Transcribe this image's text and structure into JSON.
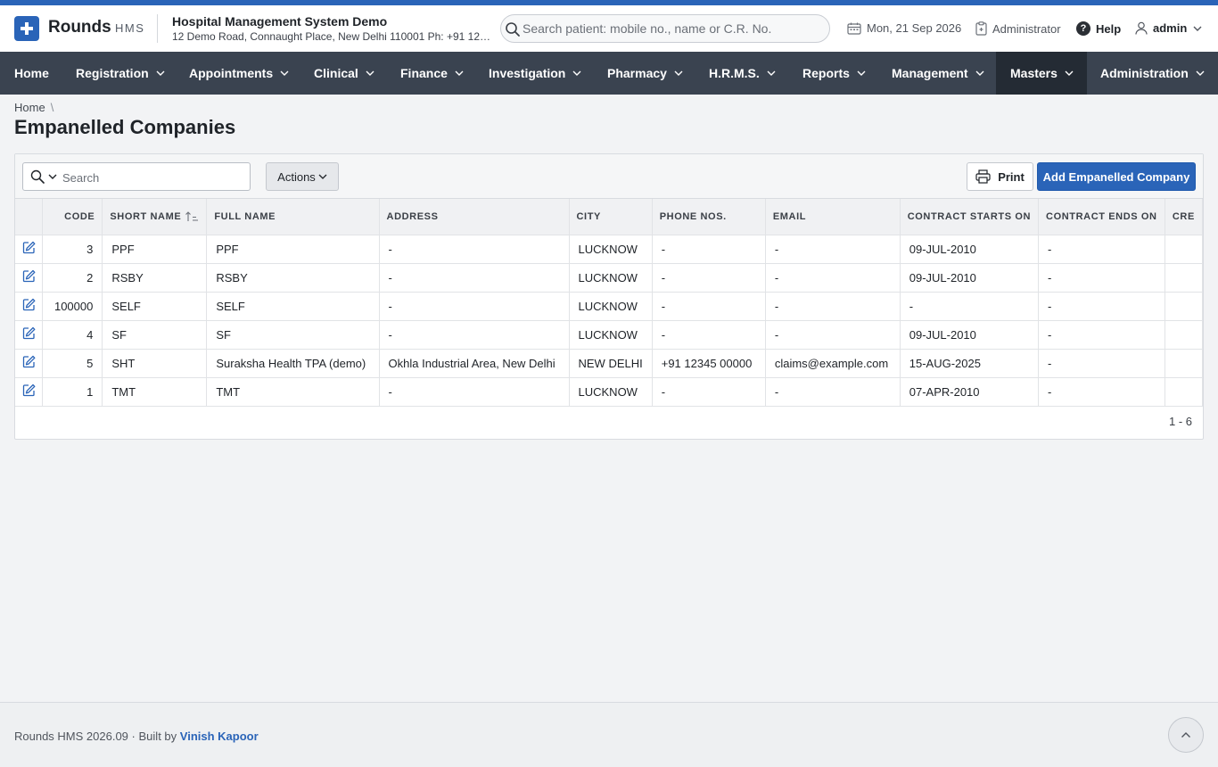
{
  "brand": {
    "name": "Rounds",
    "sub": "HMS"
  },
  "hospital": {
    "name": "Hospital Management System Demo",
    "address": "12 Demo Road, Connaught Place, New Delhi 110001 Ph: +91 123..."
  },
  "header_search": {
    "placeholder": "Search patient: mobile no., name or C.R. No."
  },
  "header": {
    "date": "Mon, 21 Sep 2026",
    "role": "Administrator",
    "help": "Help",
    "help_glyph": "?",
    "user": "admin"
  },
  "nav": {
    "items": [
      "Home",
      "Registration",
      "Appointments",
      "Clinical",
      "Finance",
      "Investigation",
      "Pharmacy",
      "H.R.M.S.",
      "Reports",
      "Management",
      "Masters",
      "Administration"
    ],
    "active": "Masters"
  },
  "breadcrumb": {
    "home": "Home",
    "separator": "\\"
  },
  "page": {
    "title": "Empanelled Companies"
  },
  "toolbar": {
    "search_placeholder": "Search",
    "actions_label": "Actions",
    "print_label": "Print",
    "add_label": "Add Empanelled Company"
  },
  "table": {
    "columns": [
      "CODE",
      "SHORT NAME",
      "FULL NAME",
      "ADDRESS",
      "CITY",
      "PHONE NOS.",
      "EMAIL",
      "CONTRACT STARTS ON",
      "CONTRACT ENDS ON",
      "CRE"
    ],
    "sorted_column": "SHORT NAME",
    "sort_direction": "ascending",
    "rows": [
      [
        "3",
        "PPF",
        "PPF",
        "-",
        "LUCKNOW",
        "-",
        "-",
        "09-JUL-2010",
        "-",
        ""
      ],
      [
        "2",
        "RSBY",
        "RSBY",
        "-",
        "LUCKNOW",
        "-",
        "-",
        "09-JUL-2010",
        "-",
        ""
      ],
      [
        "100000",
        "SELF",
        "SELF",
        "-",
        "LUCKNOW",
        "-",
        "-",
        "-",
        "-",
        ""
      ],
      [
        "4",
        "SF",
        "SF",
        "-",
        "LUCKNOW",
        "-",
        "-",
        "09-JUL-2010",
        "-",
        ""
      ],
      [
        "5",
        "SHT",
        "Suraksha Health TPA (demo)",
        "Okhla Industrial Area, New Delhi",
        "NEW DELHI",
        "+91 12345 00000",
        "claims@example.com",
        "15-AUG-2025",
        "-",
        ""
      ],
      [
        "1",
        "TMT",
        "TMT",
        "-",
        "LUCKNOW",
        "-",
        "-",
        "07-APR-2010",
        "-",
        ""
      ]
    ],
    "pagination": "1 - 6"
  },
  "footer": {
    "app_version": "Rounds HMS 2026.09",
    "dot": "·",
    "built_by": "Built by",
    "author": "Vinish Kapoor"
  },
  "colors": {
    "accent": "#2a64b8",
    "nav_bg": "#3a4350",
    "nav_active": "#242b34",
    "page_bg": "#f2f3f5"
  },
  "icons": [
    "plus-icon",
    "search-icon",
    "calendar-icon",
    "clipboard-icon",
    "help-icon",
    "user-icon",
    "chevron-down-icon",
    "sort-asc-icon",
    "edit-icon",
    "printer-icon",
    "chevron-up-icon"
  ]
}
